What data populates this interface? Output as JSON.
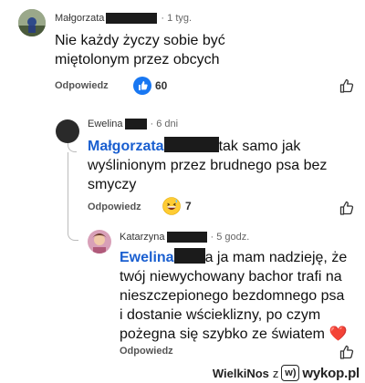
{
  "comments": [
    {
      "author": "Małgorzata",
      "time": "· 1 tyg.",
      "text": "Nie każdy życzy sobie być miętolonym przez obcych",
      "reply_label": "Odpowiedz",
      "reactions": "60",
      "reaction_icon": "thumbs-up-blue-icon",
      "like_icon": "thumbs-up-outline-icon"
    },
    {
      "author": "Ewelina",
      "time": "· 6 dni",
      "mention": "Małgorzata",
      "text_line1": "tak samo jak",
      "text_rest": "wyślinionym przez brudnego psa bez smyczy",
      "reply_label": "Odpowiedz",
      "reactions": "7",
      "reaction_icon": "grinning-sweat-emoji-icon",
      "like_icon": "thumbs-up-outline-icon"
    },
    {
      "author": "Katarzyna",
      "time": "· 5 godz.",
      "mention": "Ewelina",
      "text": "a ja mam nadzieję, że twój niewychowany bachor trafi na nieszczepionego bezdomnego psa i dostanie wścieklizny, po czym pożegna się szybko ze światem",
      "heart": "❤️",
      "reply_label": "Odpowiedz",
      "like_icon": "thumbs-up-outline-icon"
    }
  ],
  "footer": {
    "user": "WielkiNos",
    "connector": "z",
    "logo_mark": "w)",
    "site": "wykop.pl"
  },
  "colors": {
    "mention": "#1a5fd0",
    "reaction_blue": "#1877f2",
    "heart": "#e0245e"
  }
}
